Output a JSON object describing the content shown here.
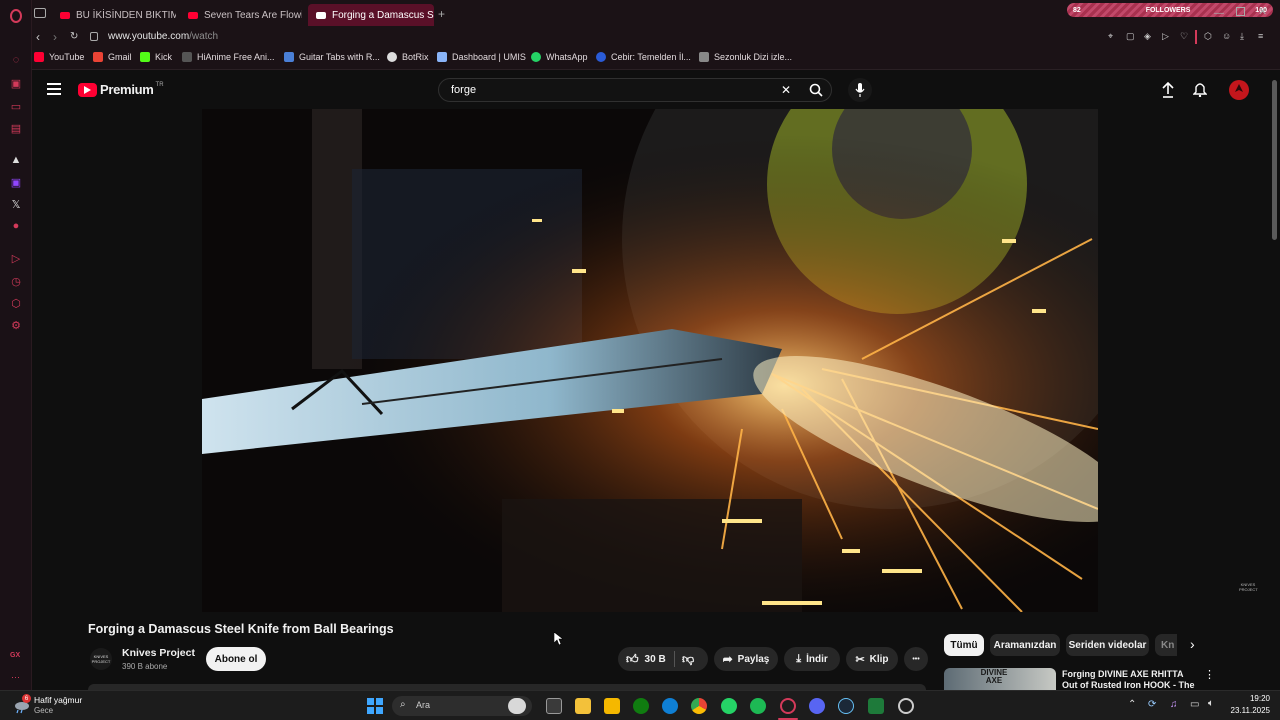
{
  "tabs": [
    {
      "label": "BU İKİSİNDEN BIKTIM ULAN"
    },
    {
      "label": "Seven Tears Are Flowing"
    },
    {
      "label": "Forging a Damascus S"
    }
  ],
  "new_tab_symbol": "+",
  "followers_widget": {
    "left": "82",
    "label": "FOLLOWERS",
    "right": "100"
  },
  "address": {
    "host": "www.youtube.com",
    "path": "/watch"
  },
  "bookmarks": [
    {
      "label": "YouTube",
      "color": "#ff0033"
    },
    {
      "label": "Gmail",
      "color": "#ea4335"
    },
    {
      "label": "Kick",
      "color": "#53fc18"
    },
    {
      "label": "HiAnime Free Ani...",
      "color": "#555555"
    },
    {
      "label": "Guitar Tabs with R...",
      "color": "#4a7fd6"
    },
    {
      "label": "BotRix",
      "color": "#dddddd"
    },
    {
      "label": "Dashboard | UMIS",
      "color": "#8ab4f8"
    },
    {
      "label": "WhatsApp",
      "color": "#25d366"
    },
    {
      "label": "Cebir: Temelden İl...",
      "color": "#2a5bd7"
    },
    {
      "label": "Sezonluk Dizi izle...",
      "color": "#888888"
    }
  ],
  "yt": {
    "logo": "Premium",
    "logo_region": "TR",
    "search_value": "forge",
    "clear_symbol": "✕"
  },
  "video": {
    "title": "Forging a Damascus Steel Knife from Ball Bearings",
    "watermark": "KNIVES PROJECT"
  },
  "channel": {
    "avatar_text": "KNIVES PROJECT",
    "name": "Knives Project",
    "subscribers": "390 B abone",
    "subscribe_label": "Abone ol"
  },
  "actions": {
    "likes": "30 B",
    "share": "Paylaş",
    "download": "İndir",
    "clip": "Klip",
    "more": "•••"
  },
  "filter_chips": [
    "Tümü",
    "Aramanızdan",
    "Seriden videolar",
    "Kn"
  ],
  "recommendation": {
    "title": "Forging DIVINE AXE RHITTA Out of Rusted Iron HOOK - The",
    "thumb_text": "DIVINE AXE"
  },
  "sidebar_bottom_label": "GX",
  "weather": {
    "title": "Hafif yağmur",
    "subtitle": "Gece",
    "badge": "6"
  },
  "taskbar": {
    "search_label": "Ara",
    "time": "19:20",
    "date": "23.11.2025"
  },
  "colors": {
    "accent": "#ff0033",
    "opera": "#d33a5a",
    "tab_active": "#5a1028"
  }
}
